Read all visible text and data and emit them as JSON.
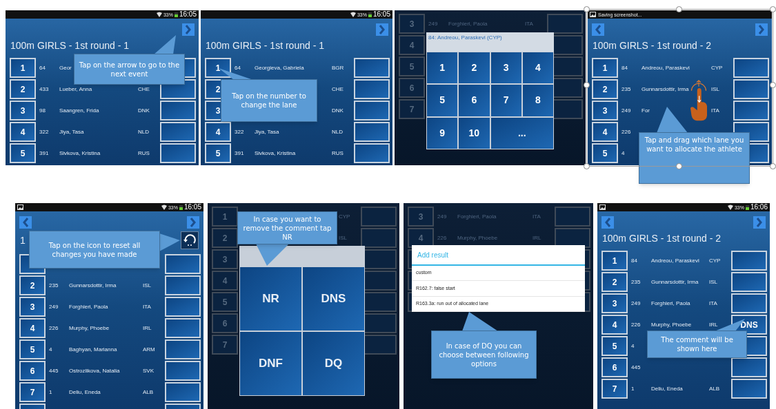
{
  "panels": [
    {
      "kind": "event",
      "status_bar": {
        "kind": "clock",
        "picture_icon": false,
        "battery": "33%",
        "time": "16:05"
      },
      "nav": {
        "back": false,
        "forward": true
      },
      "title": "100m GIRLS - 1st round - 1",
      "rows": [
        {
          "lane": "1",
          "bib": "64",
          "name": "Geor"
        },
        {
          "lane": "2",
          "bib": "433",
          "name": "Lueber, Anna",
          "country": "CHE"
        },
        {
          "lane": "3",
          "bib": "98",
          "name": "Saangren, Frida",
          "country": "DNK"
        },
        {
          "lane": "4",
          "bib": "322",
          "name": "Jiya, Tasa",
          "country": "NLD"
        },
        {
          "lane": "5",
          "bib": "391",
          "name": "Sivkova, Kristina",
          "country": "RUS"
        }
      ],
      "callout": "Tap on the arrow to go to the next event"
    },
    {
      "kind": "event",
      "status_bar": {
        "kind": "clock",
        "picture_icon": false,
        "battery": "33%",
        "time": "16:05"
      },
      "nav": {
        "back": false,
        "forward": true
      },
      "title": "100m GIRLS - 1st round - 1",
      "rows": [
        {
          "lane": "1",
          "bib": "64",
          "name": "Georgieva, Gabriela",
          "country": "BGR"
        },
        {
          "lane": "2",
          "country": "CHE"
        },
        {
          "lane": "3",
          "country": "DNK"
        },
        {
          "lane": "4",
          "bib": "322",
          "name": "Jiya, Tasa",
          "country": "NLD"
        },
        {
          "lane": "5",
          "bib": "391",
          "name": "Sivkova, Kristina",
          "country": "RUS"
        }
      ],
      "callout": "Tap on the number to change the lane"
    },
    {
      "kind": "keypad",
      "rows": [
        {
          "lane": "3",
          "bib": "249",
          "name": "Forghieri, Paola",
          "country": "ITA"
        },
        {
          "lane": "4"
        },
        {
          "lane": "5"
        },
        {
          "lane": "6"
        },
        {
          "lane": "7"
        }
      ],
      "dialog": {
        "title": "84: Andreou, Paraskevi (CYP)",
        "keys": [
          "1",
          "2",
          "3",
          "4",
          "5",
          "6",
          "7",
          "8",
          "9",
          "10",
          "..."
        ]
      }
    },
    {
      "kind": "event",
      "status_bar": {
        "kind": "notification",
        "text": "Saving screenshot..."
      },
      "nav": {
        "back": true,
        "forward": true
      },
      "title": "100m GIRLS - 1st round - 2",
      "drag_gesture": true,
      "rows": [
        {
          "lane": "1",
          "bib": "84",
          "name": "Andreou, Paraskevi",
          "country": "CYP"
        },
        {
          "lane": "2",
          "bib": "235",
          "name": "Gunnarsdottir, Irma",
          "country": "ISL"
        },
        {
          "lane": "3",
          "bib": "249",
          "name": "For",
          "country": "ITA"
        },
        {
          "lane": "4",
          "bib": "226"
        },
        {
          "lane": "5",
          "bib": "4"
        }
      ],
      "callout": "Tap and drag which lane you want to allocate the athlete"
    },
    {
      "kind": "event",
      "status_bar": {
        "kind": "clock",
        "picture_icon": true,
        "battery": "33%",
        "time": "16:05"
      },
      "nav": {
        "back": true,
        "forward": true,
        "reset": true
      },
      "title": "1",
      "rows": [
        {},
        {
          "lane": "2",
          "bib": "235",
          "name": "Gunnarsdottir, Irma",
          "country": "ISL"
        },
        {
          "lane": "3",
          "bib": "249",
          "name": "Forghieri, Paola",
          "country": "ITA"
        },
        {
          "lane": "4",
          "bib": "226",
          "name": "Murphy, Phoebe",
          "country": "IRL"
        },
        {
          "lane": "5",
          "bib": "4",
          "name": "Baghyan, Marianna",
          "country": "ARM"
        },
        {
          "lane": "6",
          "bib": "445",
          "name": "Ostrozlikova, Natalia",
          "country": "SVK"
        },
        {
          "lane": "7",
          "bib": "1",
          "name": "Deliu, Eneda",
          "country": "ALB"
        },
        {}
      ],
      "callout": "Tap on the icon to reset all changes you have made"
    },
    {
      "kind": "result_codes",
      "rows": [
        {
          "lane": "1",
          "country": "CYP"
        },
        {
          "lane": "2",
          "country": "ISL"
        },
        {
          "lane": "3"
        },
        {
          "lane": "4"
        },
        {
          "lane": "5"
        },
        {
          "lane": "6"
        },
        {
          "lane": "7"
        }
      ],
      "dialog": {
        "keys": [
          "NR",
          "DNS",
          "DNF",
          "DQ"
        ]
      },
      "callout": "In case you want to remove the comment tap NR"
    },
    {
      "kind": "result_menu",
      "rows": [
        {
          "lane": "3",
          "bib": "249",
          "name": "Forghieri, Paola",
          "country": "ITA"
        },
        {
          "lane": "4",
          "bib": "226",
          "name": "Murphy, Phoebe",
          "country": "IRL"
        },
        {},
        {},
        {}
      ],
      "dialog": {
        "title": "Add result",
        "options": [
          "custom",
          "R162.7: false start",
          "R163.3a: run out of allocated lane"
        ]
      },
      "callout": "In case of DQ you can choose between following options"
    },
    {
      "kind": "event",
      "status_bar": {
        "kind": "clock",
        "picture_icon": true,
        "battery": "33%",
        "time": "16:06"
      },
      "nav": {
        "back": true,
        "forward": true
      },
      "title": "100m GIRLS - 1st round - 2",
      "rows": [
        {
          "lane": "1",
          "bib": "84",
          "name": "Andreou, Paraskevi",
          "country": "CYP"
        },
        {
          "lane": "2",
          "bib": "235",
          "name": "Gunnarsdottir, Irma",
          "country": "ISL"
        },
        {
          "lane": "3",
          "bib": "249",
          "name": "Forghieri, Paola",
          "country": "ITA"
        },
        {
          "lane": "4",
          "bib": "226",
          "name": "Murphy, Phoebe",
          "country": "IRL",
          "result": "DNS"
        },
        {
          "lane": "5",
          "bib": "4"
        },
        {
          "lane": "6",
          "bib": "445"
        },
        {
          "lane": "7",
          "bib": "1",
          "name": "Deliu, Eneda",
          "country": "ALB"
        }
      ],
      "callout": "The comment will be shown here"
    }
  ]
}
